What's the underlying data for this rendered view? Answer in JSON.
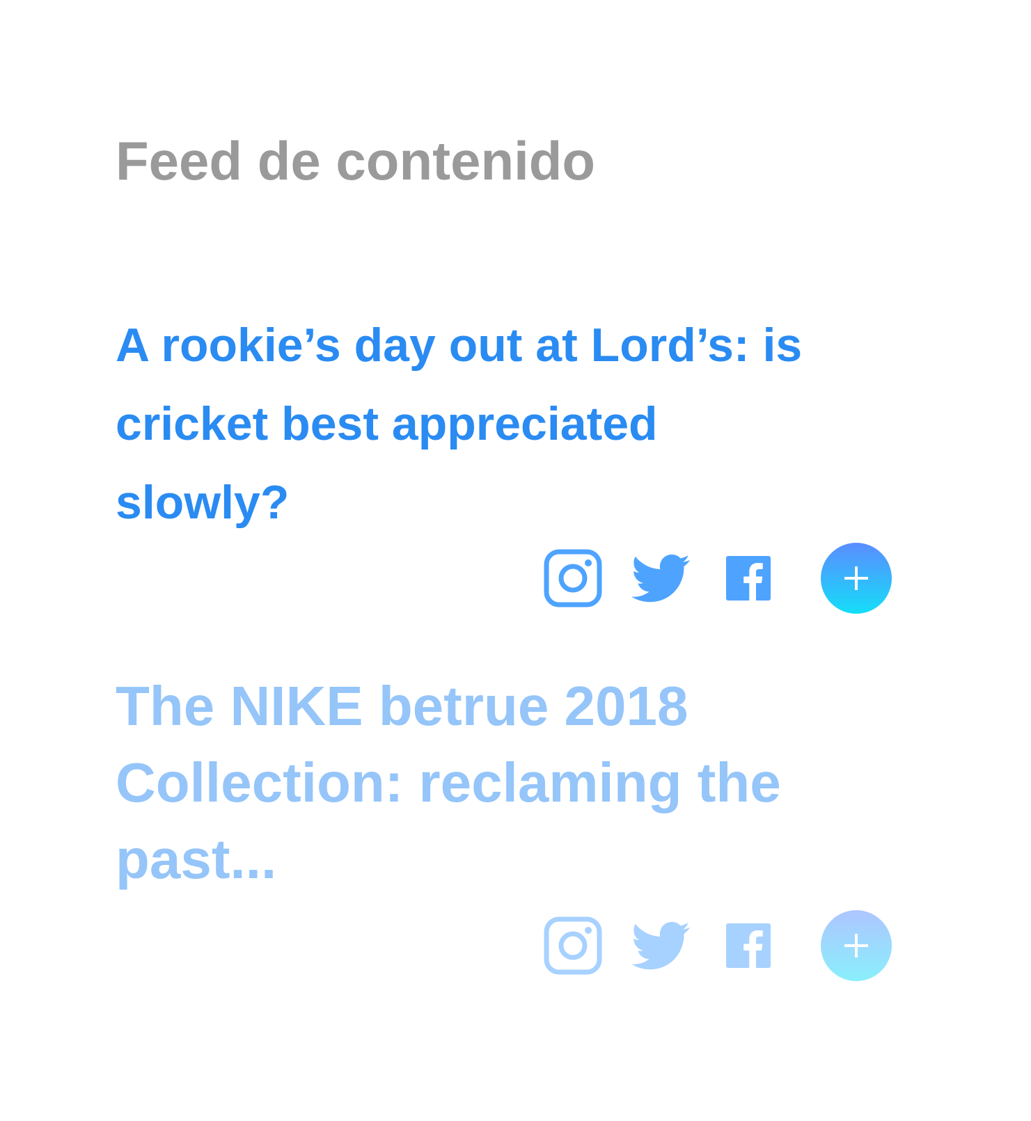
{
  "page": {
    "title": "Feed de contenido"
  },
  "articles": [
    {
      "headline": "A rookie’s day out at Lord’s: is cricket best appreciated slowly?",
      "actions": [
        "instagram-icon",
        "twitter-icon",
        "facebook-icon",
        "plus-icon"
      ]
    },
    {
      "headline": "The NIKE betrue 2018 Collection: reclaming the past...",
      "actions": [
        "instagram-icon",
        "twitter-icon",
        "facebook-icon",
        "plus-icon"
      ]
    }
  ],
  "colors": {
    "title": "#9a9a9a",
    "headline": "#2a8bf2",
    "icon": "#4ea3ff",
    "add_button_gradient_top": "#5b8cff",
    "add_button_gradient_bottom": "#14def9"
  }
}
